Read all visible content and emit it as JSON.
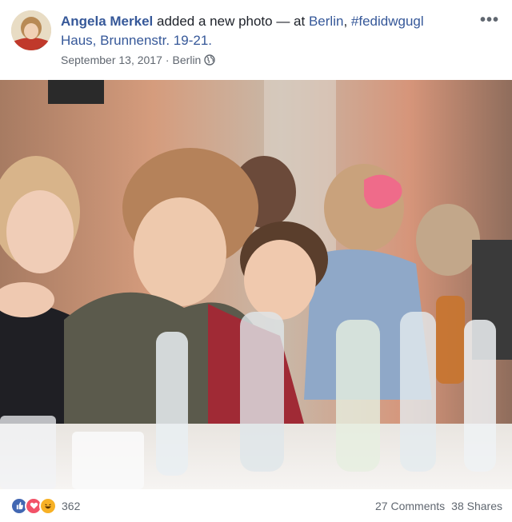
{
  "post": {
    "author": "Angela Merkel",
    "action_text": " added a new photo — at ",
    "place_link": "Berlin",
    "hashtag": "#fedidwgugl",
    "venue": "Haus, Brunnenstr. 19-21.",
    "date": "September 13, 2017",
    "separator": " · ",
    "location": "Berlin",
    "privacy_icon": "globe-icon",
    "more_icon": "more-options-icon"
  },
  "footer": {
    "reaction_icons": [
      "like-icon",
      "love-icon",
      "haha-icon"
    ],
    "reaction_count": "362",
    "comments": "27 Comments",
    "shares": "38 Shares"
  },
  "colors": {
    "link": "#365899",
    "meta": "#606770",
    "like": "#4267b2",
    "love": "#f25268",
    "haha": "#f7b125"
  }
}
